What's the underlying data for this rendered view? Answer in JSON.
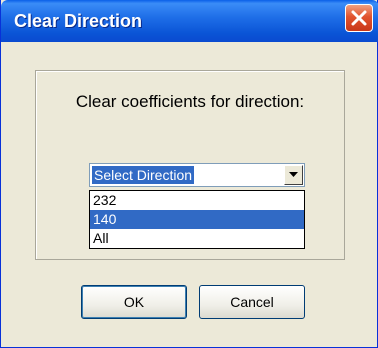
{
  "window": {
    "title": "Clear Direction"
  },
  "dialog": {
    "prompt": "Clear coefficients for direction:",
    "combo": {
      "selected": "Select Direction"
    },
    "dropdown": {
      "options": [
        "232",
        "140",
        "All"
      ],
      "highlighted_index": 1
    },
    "buttons": {
      "ok": "OK",
      "cancel": "Cancel"
    }
  },
  "colors": {
    "titlebar": "#0a54d6",
    "selection": "#316ac5",
    "close_button": "#e2532e",
    "dialog_bg": "#ece9d8"
  },
  "icons": {
    "close": "close-icon",
    "dropdown_arrow": "chevron-down-icon"
  }
}
